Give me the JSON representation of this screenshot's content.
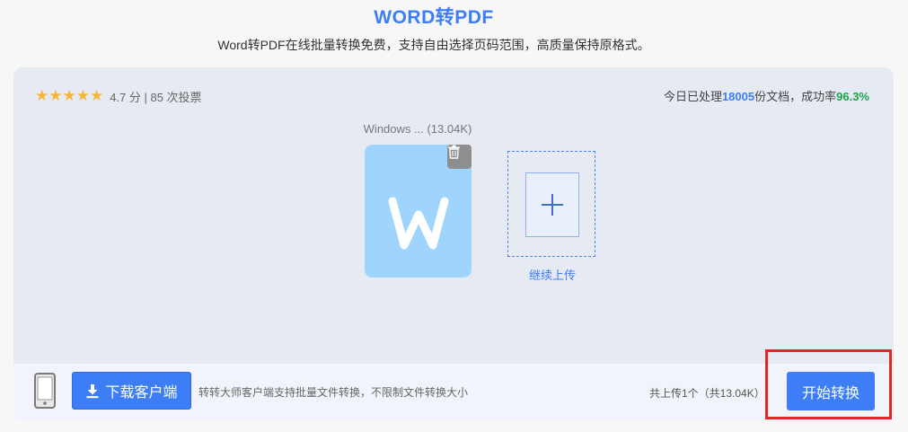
{
  "header": {
    "title": "WORD转PDF",
    "subtitle": "Word转PDF在线批量转换免费，支持自由选择页码范围，高质量保持原格式。"
  },
  "rating": {
    "stars": "★★★★★",
    "text": "4.7 分 | 85 次投票"
  },
  "stats": {
    "prefix": "今日已处理",
    "processed": "18005",
    "middle": "份文档，成功率",
    "success_rate": "96.3%"
  },
  "file": {
    "name": "Windows ...",
    "size": "(13.04K)",
    "icon": "word-file-icon"
  },
  "upload": {
    "label": "继续上传"
  },
  "bottom": {
    "download_label": "下载客户端",
    "client_note": "转转大师客户端支持批量文件转换，不限制文件转换大小",
    "upload_count": "共上传1个（共13.04K）",
    "start_label": "开始转换"
  },
  "colors": {
    "accent": "#3d7ef6",
    "success": "#1ca54a",
    "star": "#f5b73b",
    "highlight": "#e02828"
  }
}
